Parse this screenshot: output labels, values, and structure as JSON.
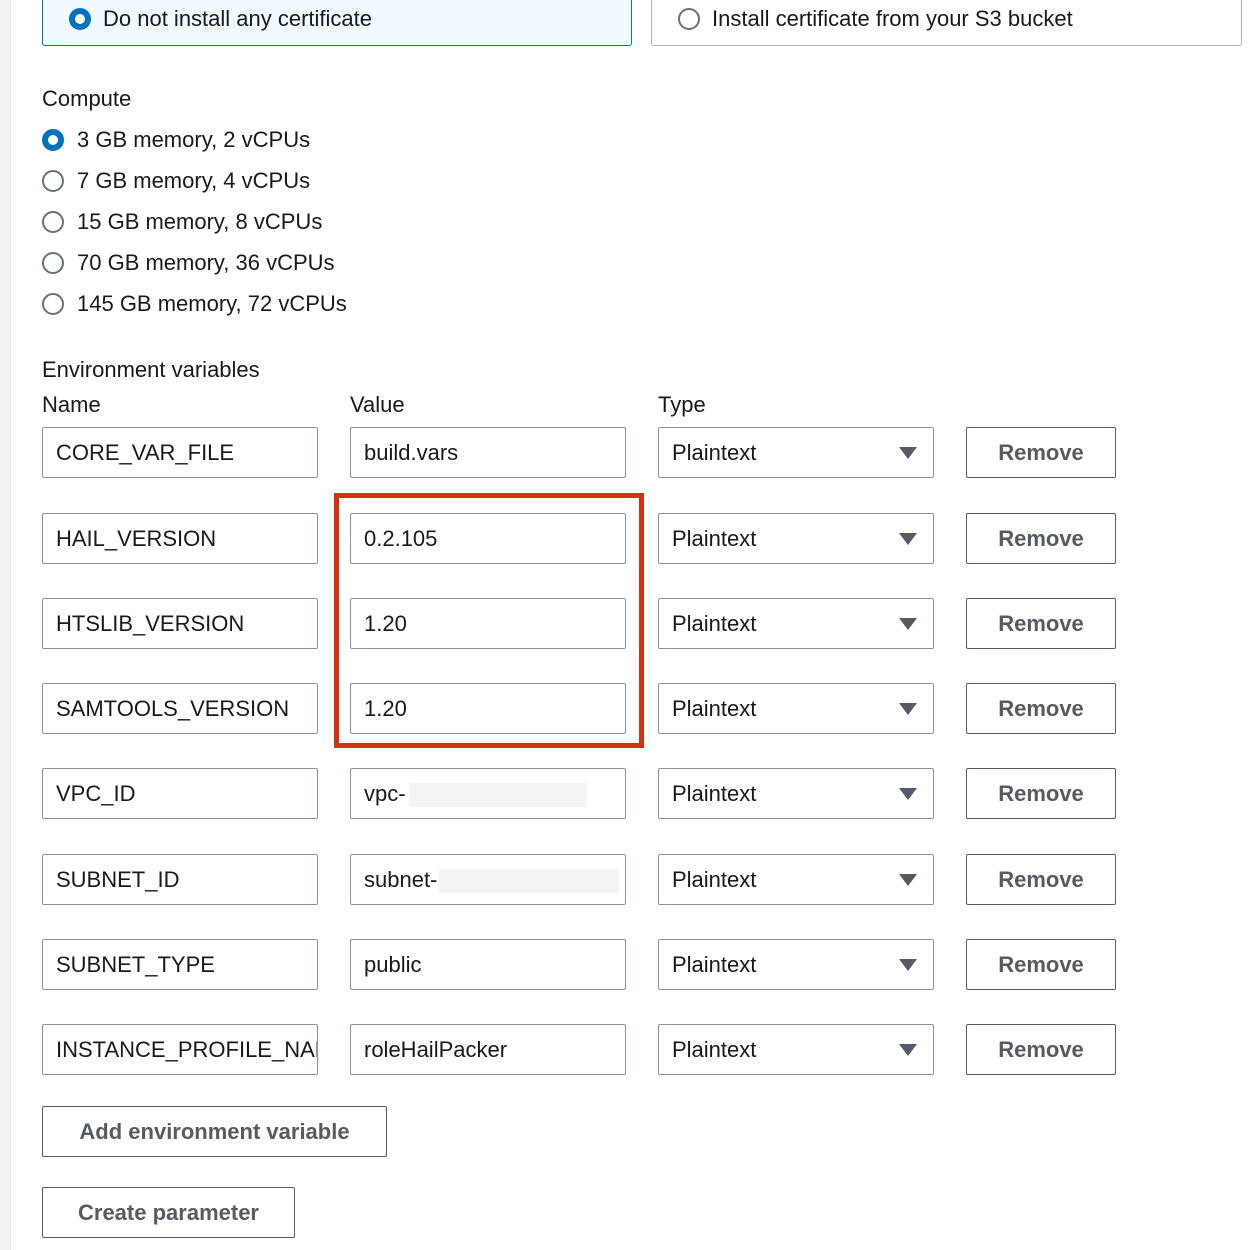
{
  "certificate": {
    "options": [
      {
        "label": "Do not install any certificate",
        "selected": true
      },
      {
        "label": "Install certificate from your S3 bucket",
        "selected": false
      }
    ]
  },
  "compute": {
    "label": "Compute",
    "options": [
      {
        "label": "3 GB memory, 2 vCPUs",
        "selected": true
      },
      {
        "label": "7 GB memory, 4 vCPUs",
        "selected": false
      },
      {
        "label": "15 GB memory, 8 vCPUs",
        "selected": false
      },
      {
        "label": "70 GB memory, 36 vCPUs",
        "selected": false
      },
      {
        "label": "145 GB memory, 72 vCPUs",
        "selected": false
      }
    ]
  },
  "env": {
    "label": "Environment variables",
    "headers": {
      "name": "Name",
      "value": "Value",
      "type": "Type"
    },
    "rows": [
      {
        "name": "CORE_VAR_FILE",
        "value": "build.vars",
        "type": "Plaintext",
        "remove": "Remove"
      },
      {
        "name": "HAIL_VERSION",
        "value": "0.2.105",
        "type": "Plaintext",
        "remove": "Remove"
      },
      {
        "name": "HTSLIB_VERSION",
        "value": "1.20",
        "type": "Plaintext",
        "remove": "Remove"
      },
      {
        "name": "SAMTOOLS_VERSION",
        "value": "1.20",
        "type": "Plaintext",
        "remove": "Remove"
      },
      {
        "name": "VPC_ID",
        "value": "vpc-",
        "type": "Plaintext",
        "remove": "Remove"
      },
      {
        "name": "SUBNET_ID",
        "value": "subnet-",
        "type": "Plaintext",
        "remove": "Remove"
      },
      {
        "name": "SUBNET_TYPE",
        "value": "public",
        "type": "Plaintext",
        "remove": "Remove"
      },
      {
        "name": "INSTANCE_PROFILE_NAME",
        "value": "roleHailPacker",
        "type": "Plaintext",
        "remove": "Remove"
      }
    ],
    "add_label": "Add environment variable"
  },
  "create_parameter_label": "Create parameter",
  "colors": {
    "accent": "#0073bb",
    "highlight": "#d13212",
    "button_text": "#545b64"
  }
}
